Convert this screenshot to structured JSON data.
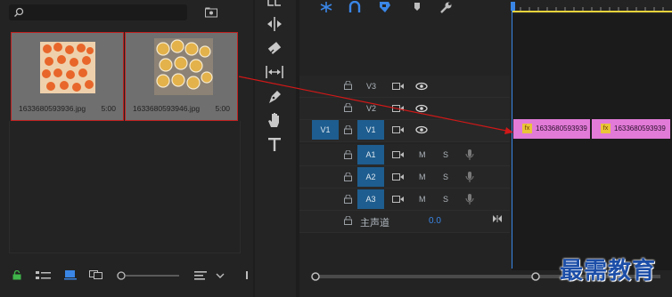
{
  "project": {
    "search_placeholder": "",
    "items": [
      {
        "name": "1633680593936.jpg",
        "duration": "5:00"
      },
      {
        "name": "1633680593946.jpg",
        "duration": "5:00"
      }
    ]
  },
  "tracks": {
    "video": [
      {
        "label": "V3"
      },
      {
        "label": "V2"
      },
      {
        "label": "V1",
        "source_label": "V1"
      }
    ],
    "audio": [
      {
        "label": "A1",
        "m": "M",
        "s": "S"
      },
      {
        "label": "A2",
        "m": "M",
        "s": "S"
      },
      {
        "label": "A3",
        "m": "M",
        "s": "S"
      }
    ],
    "master": {
      "label": "主声道",
      "value": "0.0"
    }
  },
  "clips": [
    {
      "name": "1633680593939",
      "fx": "fx"
    },
    {
      "name": "1633680593939",
      "fx": "fx"
    }
  ],
  "watermark": "最需教育",
  "colors": {
    "accent_blue": "#1e5d8f",
    "clip_pink": "#e27ad8",
    "arrow_red": "#d01818",
    "playhead": "#3a86e6"
  }
}
